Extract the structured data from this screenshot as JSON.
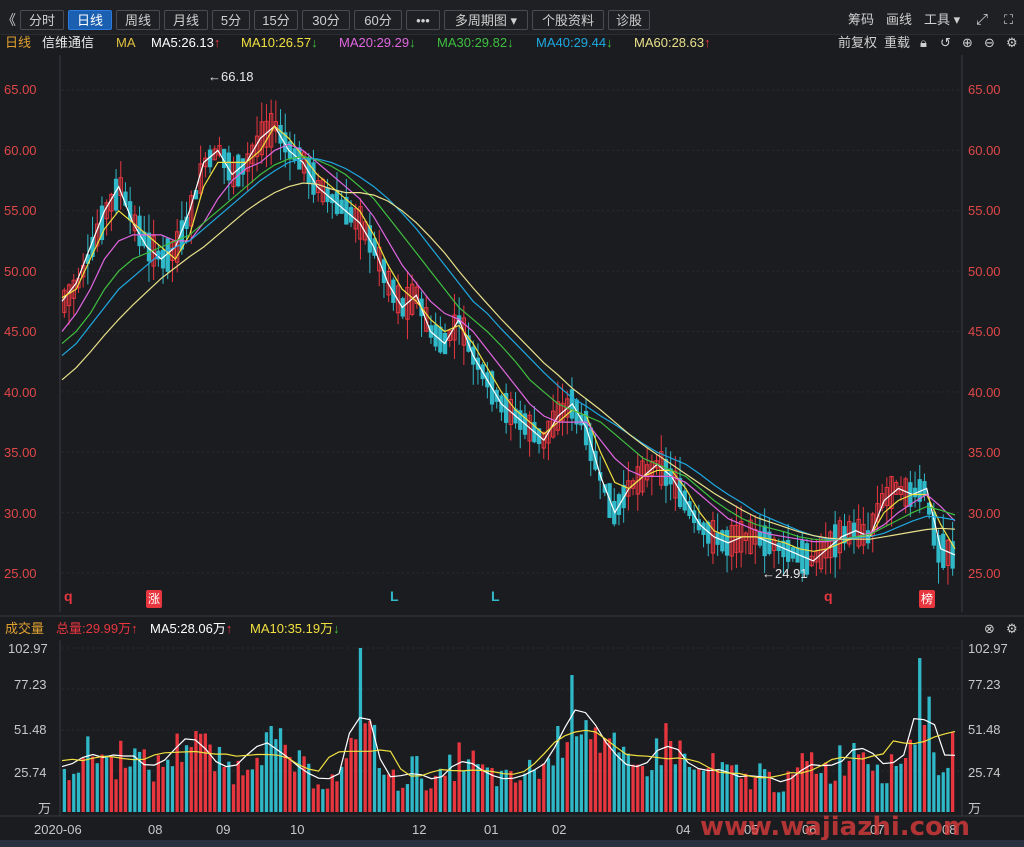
{
  "toolbar": {
    "back_glyph": "《",
    "buttons": [
      "分时",
      "日线",
      "周线",
      "月线",
      "5分",
      "15分",
      "30分",
      "60分",
      "•••",
      "多周期图 ▾",
      "个股资料",
      "诊股"
    ],
    "right_links": [
      "筹码",
      "画线",
      "工具 ▾"
    ]
  },
  "info": {
    "period": "日线",
    "stock_name": "信维通信",
    "ma_label": "MA",
    "ma5": "MA5:26.13",
    "ma10": "MA10:26.57",
    "ma20": "MA20:29.29",
    "ma30": "MA30:29.82",
    "ma40": "MA40:29.44",
    "ma60": "MA60:28.63",
    "fq": "前复权",
    "reload": "重载",
    "up_arrow": "↑",
    "down_arrow": "↓"
  },
  "colors": {
    "up": "#e8363f",
    "down": "#2fb8c8",
    "ma5": "#ffffff",
    "ma10": "#f0e040",
    "ma20": "#e066e0",
    "ma30": "#3fbf3f",
    "ma40": "#1ea8e0",
    "ma60": "#e8e08a"
  },
  "price_axis": [
    "65.00",
    "60.00",
    "55.00",
    "50.00",
    "45.00",
    "40.00",
    "35.00",
    "30.00",
    "25.00"
  ],
  "annotations": {
    "high": "←66.18",
    "low": "←24.91"
  },
  "markers": {
    "q1": "q",
    "zhang": "涨",
    "l1": "L",
    "l2": "L",
    "q2": "q",
    "bang": "榜"
  },
  "volume": {
    "title": "成交量",
    "total": "总量:29.99万",
    "ma5": "MA5:28.06万",
    "ma10": "MA10:35.19万",
    "axis": [
      "102.97",
      "77.23",
      "51.48",
      "25.74",
      "万"
    ]
  },
  "x_axis": [
    "2020-06",
    "08",
    "09",
    "10",
    "12",
    "01",
    "02",
    "04",
    "05",
    "06",
    "07",
    "08"
  ],
  "watermark": "www.wajiazhi.com",
  "chart_data": {
    "type": "line",
    "title": "信维通信 日线",
    "ylim": [
      24,
      67
    ],
    "high": 66.18,
    "low": 24.91,
    "series": [
      {
        "name": "MA5",
        "values": [
          47.5,
          49,
          52,
          55,
          57,
          54,
          52,
          51,
          52,
          55,
          59,
          60,
          58,
          59,
          61,
          62,
          60,
          59,
          57,
          56,
          55,
          54,
          52,
          49,
          47,
          48,
          45,
          44,
          46,
          43,
          41,
          39,
          38,
          37,
          36,
          38,
          39,
          37,
          33,
          30,
          32,
          33,
          34,
          33,
          31,
          29,
          28,
          27.5,
          28,
          28,
          27.5,
          27,
          26.5,
          26,
          27,
          28,
          28.5,
          28,
          31,
          32,
          31.5,
          32,
          27,
          26.5
        ]
      },
      {
        "name": "MA10",
        "values": [
          47.8,
          48.5,
          51,
          53.5,
          55,
          54,
          53,
          52,
          51,
          53,
          57,
          59,
          59,
          59,
          60,
          62,
          61,
          59.5,
          58,
          57,
          56,
          55,
          53,
          50.5,
          48.5,
          47.5,
          46,
          45,
          45.5,
          44,
          42,
          40,
          38.5,
          37.5,
          36.5,
          37.5,
          38.5,
          38,
          35,
          32.5,
          32,
          33,
          33.5,
          33.5,
          32,
          30,
          28.5,
          28,
          28,
          28,
          27.8,
          27.5,
          27,
          26.8,
          27,
          27.5,
          28,
          28,
          30,
          31,
          31.5,
          31.5,
          29,
          27
        ]
      },
      {
        "name": "MA20",
        "values": [
          45,
          46.5,
          48.5,
          51,
          52.5,
          53,
          53,
          53,
          52.5,
          52.5,
          54,
          56,
          57.5,
          58.5,
          59,
          60,
          60.5,
          60,
          59,
          58,
          57,
          56,
          54.5,
          52.5,
          50.5,
          49,
          47.5,
          46.5,
          46,
          45,
          43.5,
          42,
          40.5,
          39,
          38,
          37.5,
          37.5,
          37.5,
          36,
          34.5,
          33.5,
          33,
          33,
          33,
          32.5,
          31.5,
          30.5,
          29.5,
          29,
          28.5,
          28.2,
          28,
          27.8,
          27.6,
          27.6,
          27.8,
          28,
          28.3,
          29,
          30,
          30.8,
          31.5,
          30.5,
          29.3
        ]
      },
      {
        "name": "MA30",
        "values": [
          44,
          45,
          46.5,
          48.5,
          50,
          51,
          51.5,
          52,
          52.5,
          53,
          54,
          55,
          56,
          57,
          58,
          58.8,
          59.3,
          59.5,
          59.2,
          58.7,
          58,
          57,
          56,
          54.5,
          53,
          51.5,
          50,
          48.5,
          47,
          46,
          45,
          43.8,
          42.5,
          41,
          40,
          39,
          38.5,
          38,
          37.5,
          36.5,
          35.5,
          34.5,
          34,
          33.5,
          33,
          32,
          31,
          30.2,
          29.5,
          29,
          28.7,
          28.4,
          28,
          27.8,
          27.7,
          27.8,
          28,
          28.2,
          28.8,
          29.4,
          30,
          30.5,
          30.2,
          29.8
        ]
      },
      {
        "name": "MA40",
        "values": [
          43,
          44,
          45.5,
          47,
          48.5,
          49.5,
          50.5,
          51.5,
          52,
          52.5,
          53.5,
          54.5,
          55.5,
          56.5,
          57.5,
          58.3,
          59,
          59.3,
          59.3,
          59,
          58.5,
          57.8,
          57,
          56,
          54.8,
          53.5,
          52,
          50.5,
          49,
          47.5,
          46.5,
          45.2,
          44,
          42.8,
          41.6,
          40.5,
          39.5,
          38.8,
          38,
          37.3,
          36.5,
          35.7,
          35,
          34.5,
          34,
          33.2,
          32.3,
          31.5,
          30.8,
          30,
          29.5,
          29,
          28.5,
          28.1,
          27.8,
          27.8,
          27.9,
          28,
          28.3,
          28.8,
          29.3,
          29.7,
          29.6,
          29.4
        ]
      },
      {
        "name": "MA60",
        "values": [
          41,
          42,
          43.3,
          44.7,
          46,
          47.2,
          48.3,
          49.4,
          50.3,
          51.2,
          52,
          53,
          54,
          55,
          55.8,
          56.5,
          57,
          57.3,
          57.2,
          56.8,
          56.5,
          56.5,
          56.3,
          55.8,
          55,
          54,
          52.8,
          51.5,
          50,
          48.6,
          47.3,
          46,
          44.8,
          43.6,
          42.4,
          41.4,
          40.3,
          39.4,
          38.5,
          37.5,
          36.5,
          35.6,
          34.8,
          34,
          33.2,
          32.4,
          31.6,
          30.9,
          30.2,
          29.6,
          29.2,
          28.8,
          28.4,
          28.1,
          27.9,
          27.8,
          27.8,
          27.8,
          28,
          28.2,
          28.4,
          28.6,
          28.7,
          28.63
        ]
      }
    ],
    "volume_axis": [
      25.74,
      51.48,
      77.23,
      102.97
    ],
    "volume_unit": "万",
    "volume_total": 29.99,
    "volume_ma5": 28.06,
    "volume_ma10": 35.19,
    "volume_values": [
      28,
      32,
      36,
      40,
      38,
      30,
      45,
      36,
      30,
      28,
      35,
      40,
      50,
      55,
      38,
      32,
      30,
      28,
      35,
      50,
      45,
      42,
      36,
      30,
      25,
      22,
      20,
      24,
      32,
      100,
      55,
      28,
      22,
      20,
      30,
      26,
      18,
      22,
      30,
      38,
      32,
      26,
      24,
      22,
      20,
      25,
      28,
      30,
      38,
      60,
      70,
      72,
      55,
      45,
      38,
      30,
      26,
      34,
      38,
      50,
      42,
      32,
      24,
      30,
      28,
      26,
      24,
      20,
      28,
      22,
      18,
      20,
      28,
      34,
      32,
      26,
      35,
      40,
      48,
      38,
      30,
      28,
      40,
      45,
      100,
      38,
      35,
      40
    ]
  }
}
